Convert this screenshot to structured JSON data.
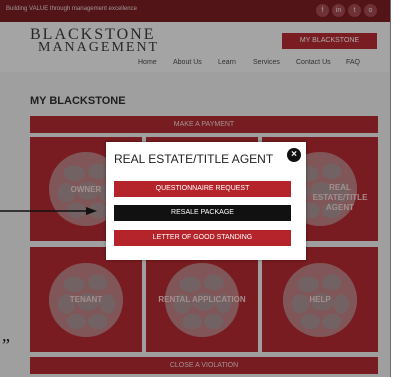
{
  "topbar": {
    "tagline": "Building VALUE through management excellence",
    "social": [
      "f",
      "in",
      "t",
      "o"
    ]
  },
  "logo": {
    "line1": "BLACKSTONE",
    "line2": "MANAGEMENT"
  },
  "header": {
    "my_blackstone_button": "MY BLACKSTONE"
  },
  "nav": [
    "Home",
    "About Us",
    "Learn",
    "Services",
    "Contact Us",
    "FAQ"
  ],
  "page": {
    "title": "MY BLACKSTONE",
    "make_payment": "MAKE A PAYMENT",
    "close_violation": "CLOSE A VIOLATION",
    "tiles": [
      {
        "label": "OWNER"
      },
      {
        "label": ""
      },
      {
        "label": "REAL ESTATE/TITLE AGENT"
      },
      {
        "label": "TENANT"
      },
      {
        "label": "RENTAL APPLICATION"
      },
      {
        "label": "HELP"
      }
    ]
  },
  "modal": {
    "title": "REAL ESTATE/TITLE AGENT",
    "close_icon": "close-icon",
    "buttons": [
      {
        "label": "QUESTIONNAIRE REQUEST",
        "color": "#b5242b"
      },
      {
        "label": "RESALE PACKAGE",
        "color": "#111111"
      },
      {
        "label": "LETTER OF GOOD STANDING",
        "color": "#b5242b"
      }
    ]
  },
  "annotation": {
    "quote": "”"
  },
  "colors": {
    "brand": "#7d1f24",
    "tile": "#b32b32",
    "accent": "#b52c33"
  }
}
